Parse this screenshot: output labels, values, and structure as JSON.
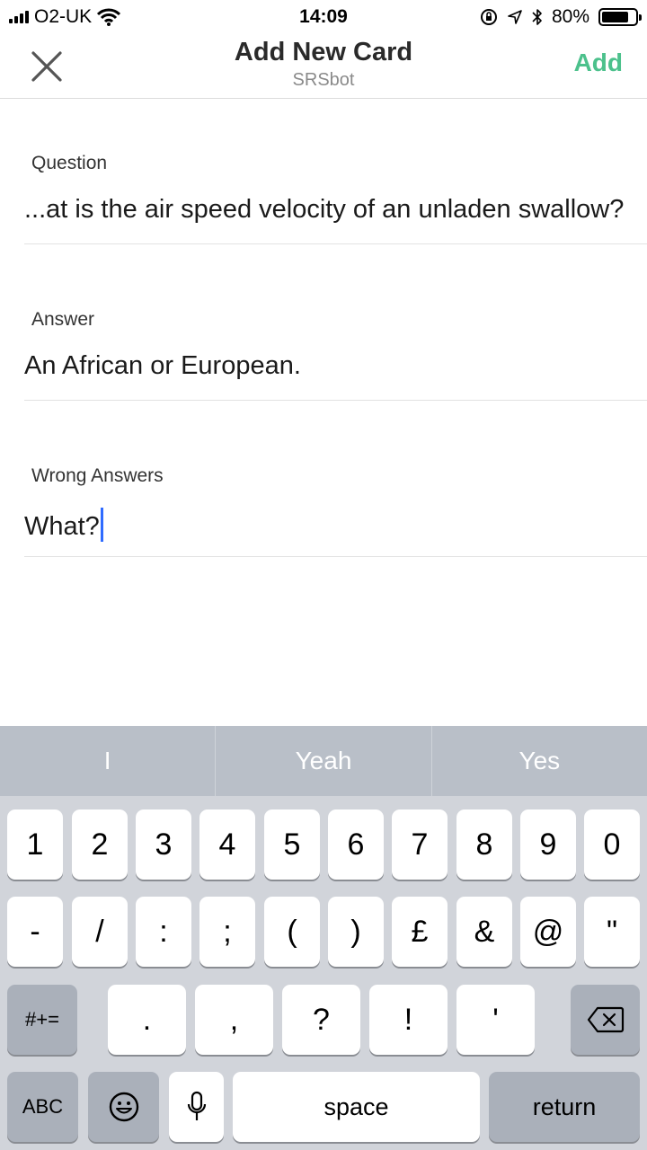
{
  "status_bar": {
    "carrier": "O2-UK",
    "time": "14:09",
    "battery_percent": "80%",
    "battery_level": 0.8,
    "icons": [
      "signal-icon",
      "wifi-icon",
      "orientation-lock-icon",
      "location-icon",
      "bluetooth-icon",
      "battery-icon"
    ]
  },
  "nav": {
    "title": "Add New Card",
    "subtitle": "SRSbot",
    "add_label": "Add",
    "close_icon": "close-icon",
    "accent_color": "#4cc18c"
  },
  "form": {
    "question_label": "Question",
    "question_value": "...at is the air speed velocity of an unladen swallow?",
    "answer_label": "Answer",
    "answer_value": "An African or European.",
    "wrong_label": "Wrong Answers",
    "wrong_value": "What?"
  },
  "keyboard": {
    "suggestions": [
      "I",
      "Yeah",
      "Yes"
    ],
    "row1": [
      "1",
      "2",
      "3",
      "4",
      "5",
      "6",
      "7",
      "8",
      "9",
      "0"
    ],
    "row2": [
      "-",
      "/",
      ":",
      ";",
      "(",
      ")",
      "£",
      "&",
      "@",
      "\""
    ],
    "row3_mode": "#+=",
    "row3": [
      ".",
      ",",
      "?",
      "!",
      "'"
    ],
    "abc_label": "ABC",
    "space_label": "space",
    "return_label": "return"
  }
}
